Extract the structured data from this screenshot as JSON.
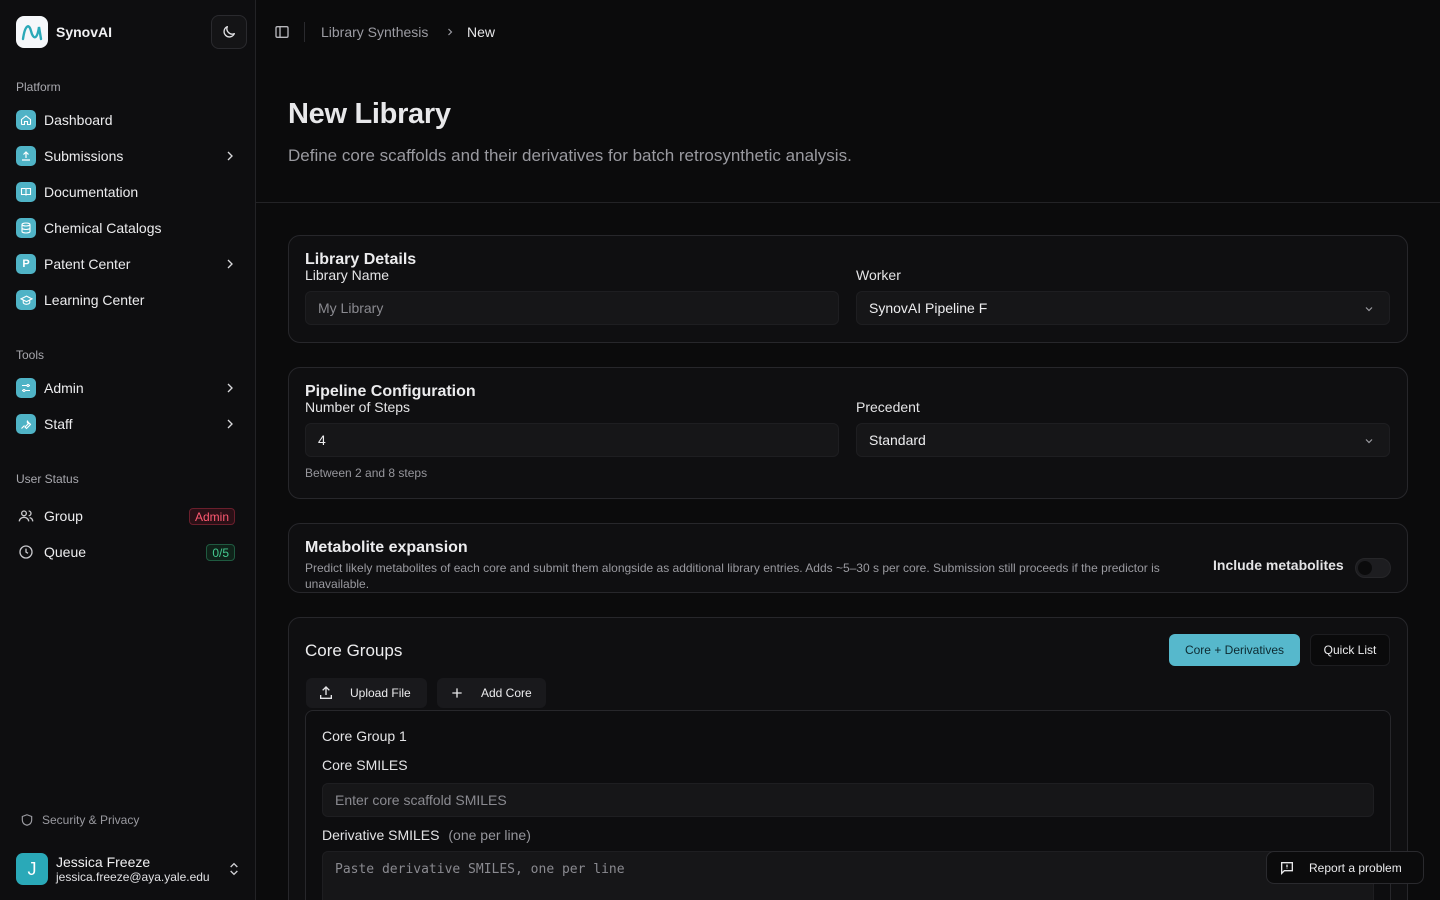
{
  "brand": {
    "name": "SynovAI"
  },
  "sidebar": {
    "platform_label": "Platform",
    "platform_items": [
      {
        "label": "Dashboard",
        "icon": "home-icon"
      },
      {
        "label": "Submissions",
        "icon": "upload-icon"
      },
      {
        "label": "Documentation",
        "icon": "book-icon"
      },
      {
        "label": "Chemical Catalogs",
        "icon": "database-icon"
      },
      {
        "label": "Patent Center",
        "icon": "p-icon",
        "icon_text": "P"
      },
      {
        "label": "Learning Center",
        "icon": "graduation-cap-icon"
      }
    ],
    "tools_label": "Tools",
    "tools_items": [
      {
        "label": "Admin",
        "icon": "sliders-icon"
      },
      {
        "label": "Staff",
        "icon": "wrench-icon"
      }
    ],
    "status_label": "User Status",
    "status_items": [
      {
        "label": "Group",
        "icon": "users-icon",
        "badge": "Admin"
      },
      {
        "label": "Queue",
        "icon": "clock-icon",
        "badge": "0/5"
      }
    ],
    "security_label": "Security & Privacy",
    "user": {
      "initial": "J",
      "name": "Jessica Freeze",
      "email": "jessica.freeze@aya.yale.edu"
    }
  },
  "breadcrumb": {
    "parent": "Library Synthesis",
    "current": "New"
  },
  "page": {
    "title": "New Library",
    "subtitle": "Define core scaffolds and their derivatives for batch retrosynthetic analysis."
  },
  "library_details": {
    "title": "Library Details",
    "name_label": "Library Name",
    "name_placeholder": "My Library",
    "worker_label": "Worker",
    "worker_value": "SynovAI Pipeline F"
  },
  "pipeline": {
    "title": "Pipeline Configuration",
    "steps_label": "Number of Steps",
    "steps_value": "4",
    "steps_hint": "Between 2 and 8 steps",
    "precedent_label": "Precedent",
    "precedent_value": "Standard"
  },
  "metabolite": {
    "title": "Metabolite expansion",
    "description": "Predict likely metabolites of each core and submit them alongside as additional library entries. Adds ~5–30 s per core. Submission still proceeds if the predictor is unavailable.",
    "toggle_label": "Include metabolites",
    "enabled": false
  },
  "core_groups": {
    "title": "Core Groups",
    "mode_active": "Core + Derivatives",
    "mode_inactive": "Quick List",
    "upload_label": "Upload File",
    "add_label": "Add Core",
    "group": {
      "title": "Core Group 1",
      "core_label": "Core SMILES",
      "core_placeholder": "Enter core scaffold SMILES",
      "deriv_label": "Derivative SMILES",
      "deriv_note": "(one per line)",
      "deriv_placeholder": "Paste derivative SMILES, one per line"
    }
  },
  "report_label": "Report a problem",
  "colors": {
    "accent": "#56b8cc",
    "danger": "#ff5a72",
    "success": "#45c98f"
  }
}
